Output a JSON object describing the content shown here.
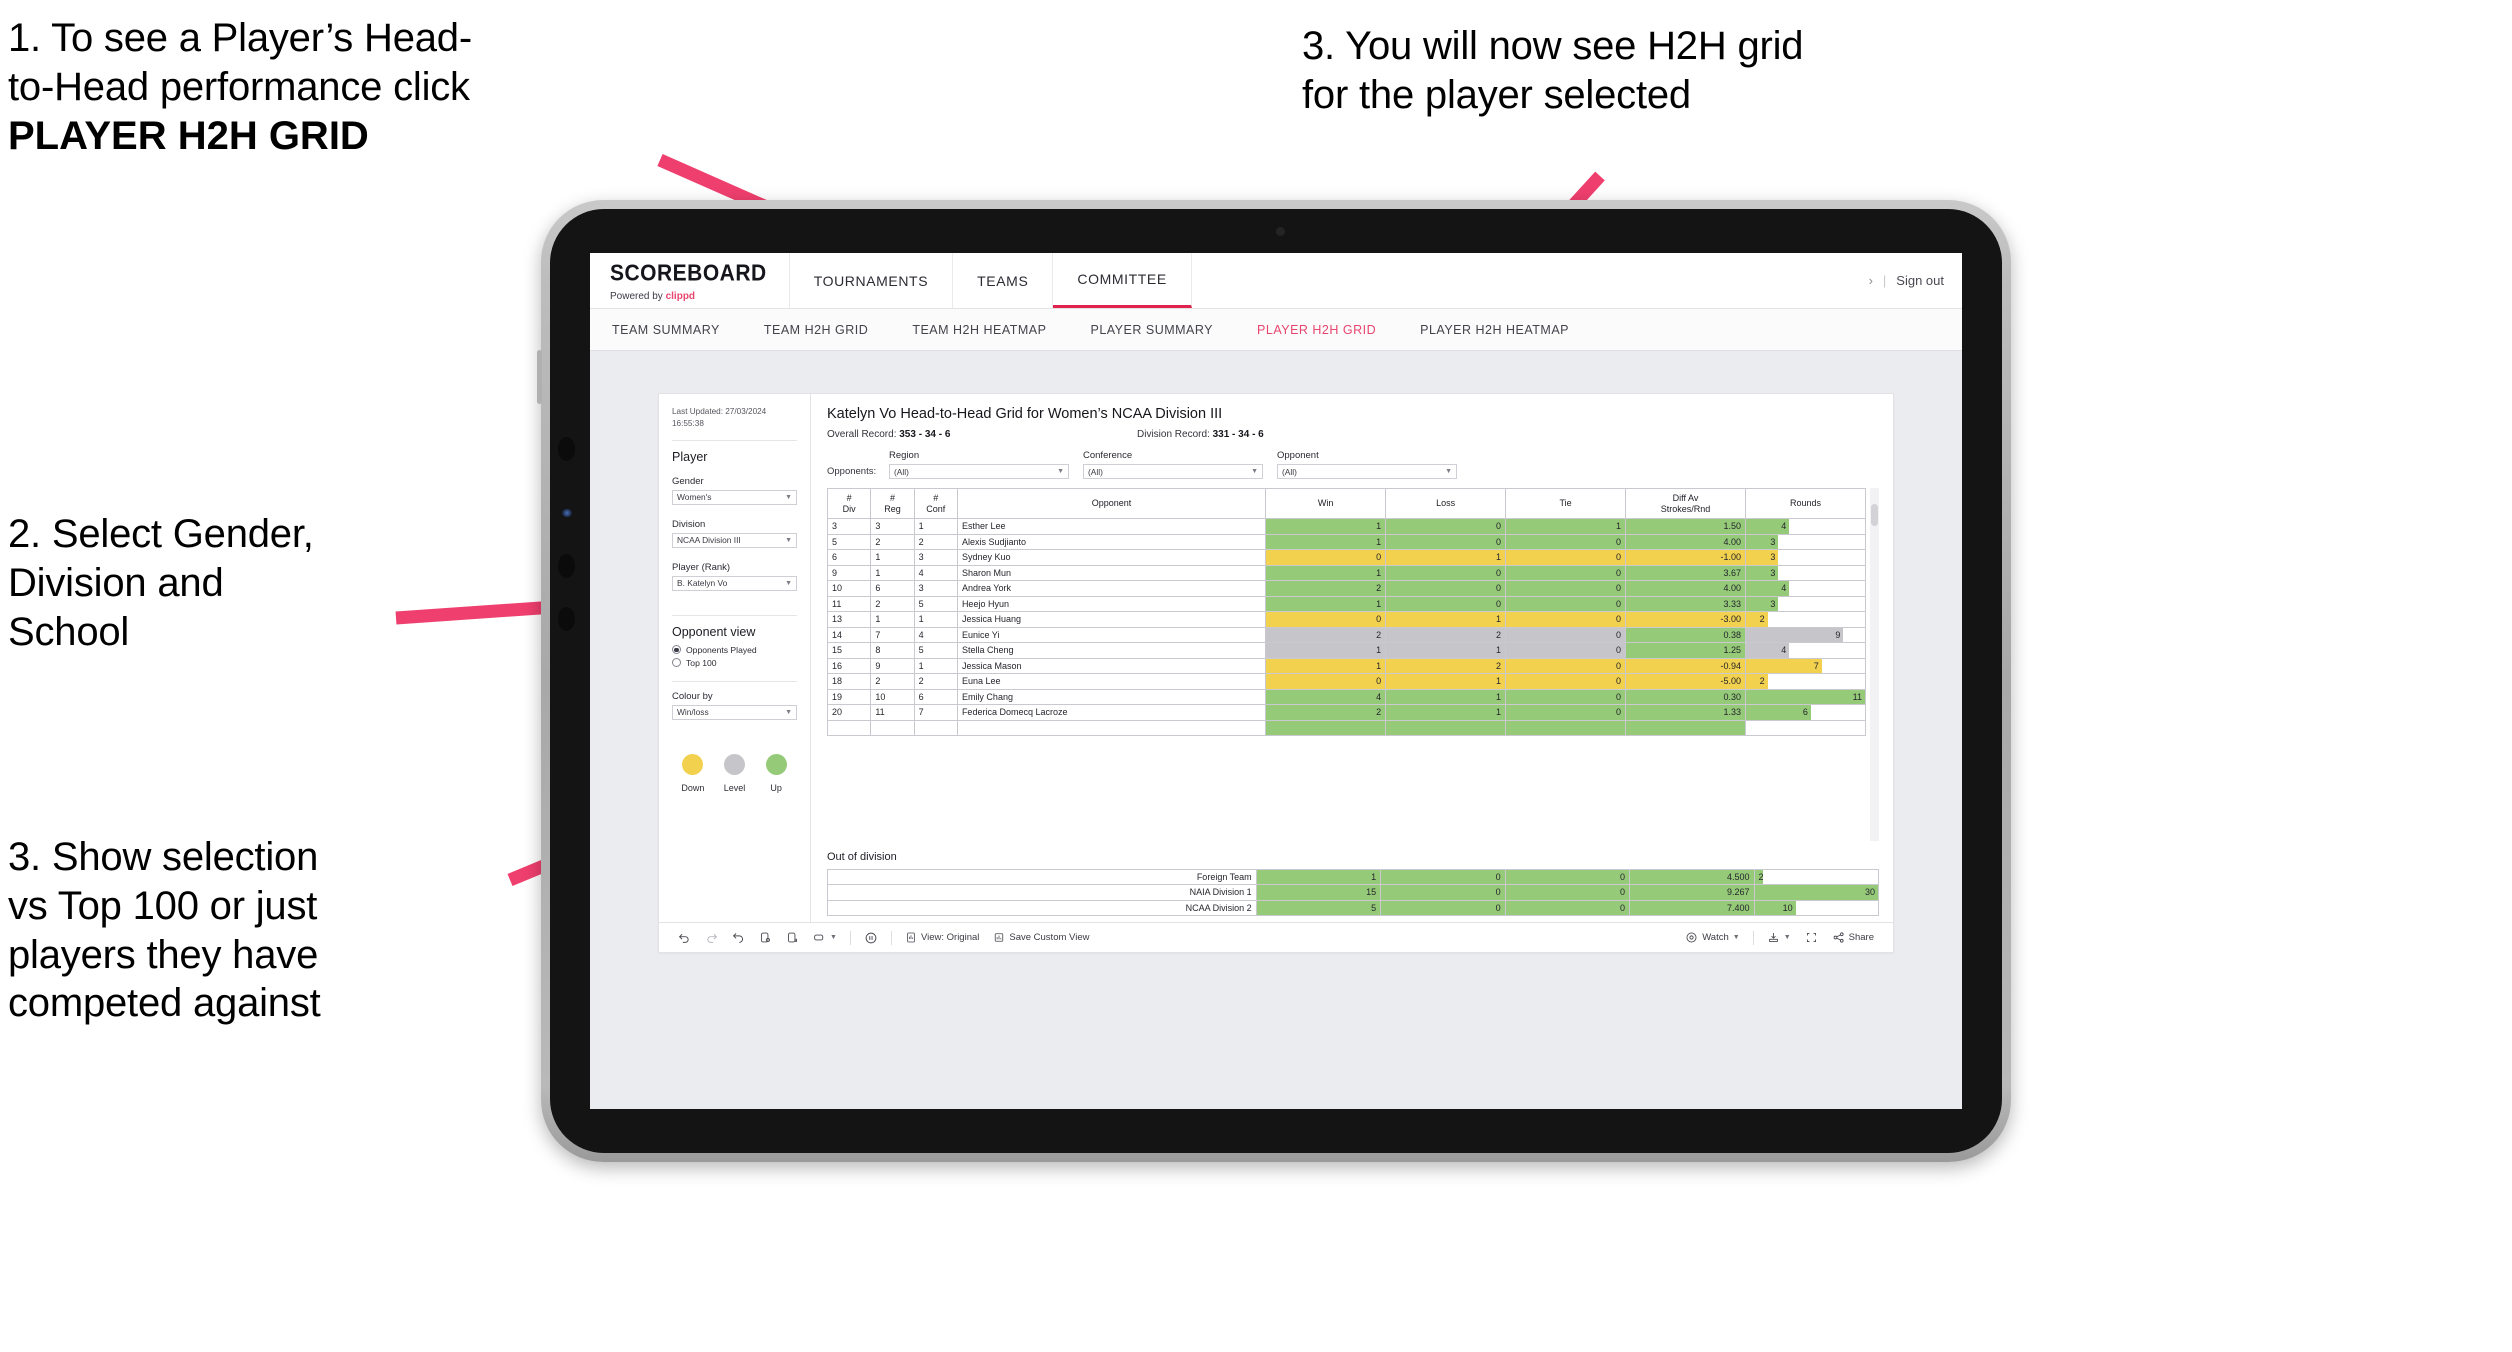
{
  "annotations": [
    {
      "id": "a1",
      "line1": "1. To see a Player’s Head-",
      "line2": "to-Head performance click",
      "line3": "PLAYER H2H GRID"
    },
    {
      "id": "a2",
      "line1": "2. Select Gender,",
      "line2": "Division and",
      "line3": "School"
    },
    {
      "id": "a3",
      "line1": "3. Show selection",
      "line2": "vs Top 100 or just",
      "line3": "players they have",
      "line4": "competed against"
    },
    {
      "id": "a4",
      "line1": "3. You will now see H2H grid",
      "line2": "for the player selected"
    }
  ],
  "colors": {
    "accent_pink": "#e8456e",
    "arrow_pink": "#ef3f6e",
    "green": "#95ca78",
    "yellow": "#f2d14e",
    "grey": "#c6c6ca",
    "bezel": "#b0b0b0"
  },
  "app": {
    "brand": {
      "name": "SCOREBOARD",
      "powered_prefix": "Powered by ",
      "powered_brand": "clippd"
    },
    "topnav": [
      {
        "label": "TOURNAMENTS",
        "active": false
      },
      {
        "label": "TEAMS",
        "active": false
      },
      {
        "label": "COMMITTEE",
        "active": true
      }
    ],
    "topnav_right": {
      "chevron": "›",
      "separator": "|",
      "signout": "Sign out"
    },
    "subnav": [
      {
        "label": "TEAM SUMMARY",
        "active": false
      },
      {
        "label": "TEAM H2H GRID",
        "active": false
      },
      {
        "label": "TEAM H2H HEATMAP",
        "active": false
      },
      {
        "label": "PLAYER SUMMARY",
        "active": false
      },
      {
        "label": "PLAYER H2H GRID",
        "active": true
      },
      {
        "label": "PLAYER H2H HEATMAP",
        "active": false
      }
    ]
  },
  "sidebar": {
    "last_updated": "Last Updated: 27/03/2024 16:55:38",
    "section_player": "Player",
    "gender": {
      "label": "Gender",
      "value": "Women's"
    },
    "division": {
      "label": "Division",
      "value": "NCAA Division III"
    },
    "player_rank": {
      "label": "Player (Rank)",
      "value": "B. Katelyn Vo"
    },
    "opponent_view": {
      "title": "Opponent view",
      "options": [
        {
          "label": "Opponents Played",
          "selected": true
        },
        {
          "label": "Top 100",
          "selected": false
        }
      ]
    },
    "colour_by": {
      "label": "Colour by",
      "value": "Win/loss"
    },
    "legend": [
      {
        "label": "Down",
        "color": "#f2d14e"
      },
      {
        "label": "Level",
        "color": "#c6c6ca"
      },
      {
        "label": "Up",
        "color": "#95ca78"
      }
    ]
  },
  "viz": {
    "title": "Katelyn Vo Head-to-Head Grid for Women’s NCAA Division III",
    "overall_record_label": "Overall Record:",
    "overall_record_value": "353 -  34 - 6",
    "division_record_label": "Division Record:",
    "division_record_value": "331 -  34 - 6",
    "opponents_label": "Opponents:",
    "filters": [
      {
        "label": "Region",
        "value": "(All)"
      },
      {
        "label": "Conference",
        "value": "(All)"
      },
      {
        "label": "Opponent",
        "value": "(All)"
      }
    ],
    "out_of_division_title": "Out of division"
  },
  "chart_data": {
    "type": "table",
    "title": "Katelyn Vo Head-to-Head Grid for Women’s NCAA Division III",
    "columns": [
      "# Div",
      "# Reg",
      "# Conf",
      "Opponent",
      "Win",
      "Loss",
      "Tie",
      "Diff Av Strokes/Rnd",
      "Rounds"
    ],
    "column_headers_multiline": [
      [
        "#",
        "Div"
      ],
      [
        "#",
        "Reg"
      ],
      [
        "#",
        "Conf"
      ],
      [
        "Opponent"
      ],
      [
        "Win"
      ],
      [
        "Loss"
      ],
      [
        "Tie"
      ],
      [
        "Diff Av",
        "Strokes/Rnd"
      ],
      [
        "Rounds"
      ]
    ],
    "rounds_max": 11,
    "rows": [
      {
        "div": "3",
        "reg": "3",
        "conf": "1",
        "opponent": "Esther Lee",
        "win": "1",
        "loss": "0",
        "tie": "1",
        "diff": "1.50",
        "rounds": "4",
        "color": "green"
      },
      {
        "div": "5",
        "reg": "2",
        "conf": "2",
        "opponent": "Alexis Sudjianto",
        "win": "1",
        "loss": "0",
        "tie": "0",
        "diff": "4.00",
        "rounds": "3",
        "color": "green"
      },
      {
        "div": "6",
        "reg": "1",
        "conf": "3",
        "opponent": "Sydney Kuo",
        "win": "0",
        "loss": "1",
        "tie": "0",
        "diff": "-1.00",
        "rounds": "3",
        "color": "yellow"
      },
      {
        "div": "9",
        "reg": "1",
        "conf": "4",
        "opponent": "Sharon Mun",
        "win": "1",
        "loss": "0",
        "tie": "0",
        "diff": "3.67",
        "rounds": "3",
        "color": "green"
      },
      {
        "div": "10",
        "reg": "6",
        "conf": "3",
        "opponent": "Andrea York",
        "win": "2",
        "loss": "0",
        "tie": "0",
        "diff": "4.00",
        "rounds": "4",
        "color": "green"
      },
      {
        "div": "11",
        "reg": "2",
        "conf": "5",
        "opponent": "Heejo Hyun",
        "win": "1",
        "loss": "0",
        "tie": "0",
        "diff": "3.33",
        "rounds": "3",
        "color": "green"
      },
      {
        "div": "13",
        "reg": "1",
        "conf": "1",
        "opponent": "Jessica Huang",
        "win": "0",
        "loss": "1",
        "tie": "0",
        "diff": "-3.00",
        "rounds": "2",
        "color": "yellow"
      },
      {
        "div": "14",
        "reg": "7",
        "conf": "4",
        "opponent": "Eunice Yi",
        "win": "2",
        "loss": "2",
        "tie": "0",
        "diff": "0.38",
        "rounds": "9",
        "color": "grey",
        "diff_color": "green"
      },
      {
        "div": "15",
        "reg": "8",
        "conf": "5",
        "opponent": "Stella Cheng",
        "win": "1",
        "loss": "1",
        "tie": "0",
        "diff": "1.25",
        "rounds": "4",
        "color": "grey",
        "diff_color": "green"
      },
      {
        "div": "16",
        "reg": "9",
        "conf": "1",
        "opponent": "Jessica Mason",
        "win": "1",
        "loss": "2",
        "tie": "0",
        "diff": "-0.94",
        "rounds": "7",
        "color": "yellow"
      },
      {
        "div": "18",
        "reg": "2",
        "conf": "2",
        "opponent": "Euna Lee",
        "win": "0",
        "loss": "1",
        "tie": "0",
        "diff": "-5.00",
        "rounds": "2",
        "color": "yellow"
      },
      {
        "div": "19",
        "reg": "10",
        "conf": "6",
        "opponent": "Emily Chang",
        "win": "4",
        "loss": "1",
        "tie": "0",
        "diff": "0.30",
        "rounds": "11",
        "color": "green"
      },
      {
        "div": "20",
        "reg": "11",
        "conf": "7",
        "opponent": "Federica Domecq Lacroze",
        "win": "2",
        "loss": "1",
        "tie": "0",
        "diff": "1.33",
        "rounds": "6",
        "color": "green"
      }
    ],
    "out_of_division": {
      "title": "Out of division",
      "rounds_max": 30,
      "rows": [
        {
          "name": "Foreign Team",
          "win": "1",
          "loss": "0",
          "tie": "0",
          "diff": "4.500",
          "rounds": "2",
          "color": "green"
        },
        {
          "name": "NAIA Division 1",
          "win": "15",
          "loss": "0",
          "tie": "0",
          "diff": "9.267",
          "rounds": "30",
          "color": "green"
        },
        {
          "name": "NCAA Division 2",
          "win": "5",
          "loss": "0",
          "tie": "0",
          "diff": "7.400",
          "rounds": "10",
          "color": "green"
        }
      ]
    }
  },
  "toolbar": {
    "undo": "undo-icon",
    "redo": "redo-icon",
    "revert": "revert-icon",
    "refresh": "refresh-data-icon",
    "pause": "pause-updates-icon",
    "view_original_label": "View: Original",
    "save_custom_view_label": "Save Custom View",
    "watch_label": "Watch",
    "share_label": "Share",
    "alert_icon": "alert-icon",
    "download_icon": "download-icon",
    "fullscreen_icon": "fullscreen-icon"
  }
}
